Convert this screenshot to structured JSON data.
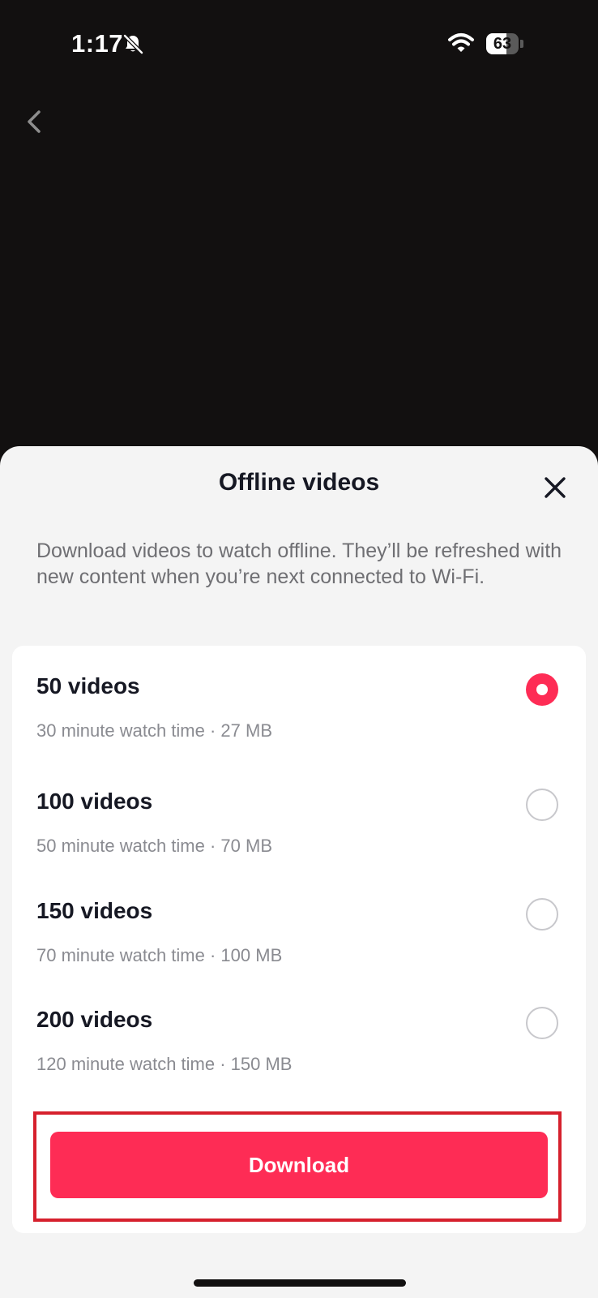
{
  "status_bar": {
    "time": "1:17",
    "battery_level": "63",
    "battery_fraction": 0.63,
    "icons": [
      "bell-slash-icon",
      "wifi-icon",
      "battery-icon"
    ]
  },
  "nav": {
    "back_icon": "chevron-left-icon"
  },
  "sheet": {
    "title": "Offline videos",
    "close_icon": "close-icon",
    "description": "Download videos to watch offline. They’ll be refreshed with new content when you’re next connected to Wi-Fi.",
    "options": [
      {
        "label": "50 videos",
        "meta": "30 minute watch time · 27 MB",
        "selected": true
      },
      {
        "label": "100 videos",
        "meta": "50 minute watch time · 70 MB",
        "selected": false
      },
      {
        "label": "150 videos",
        "meta": "70 minute watch time · 100 MB",
        "selected": false
      },
      {
        "label": "200 videos",
        "meta": "120 minute watch time · 150 MB",
        "selected": false
      }
    ],
    "download_label": "Download"
  },
  "colors": {
    "accent": "#fe2c55",
    "highlight_border": "#d6202d",
    "sheet_background": "#f4f4f4",
    "screen_background": "#121010"
  }
}
